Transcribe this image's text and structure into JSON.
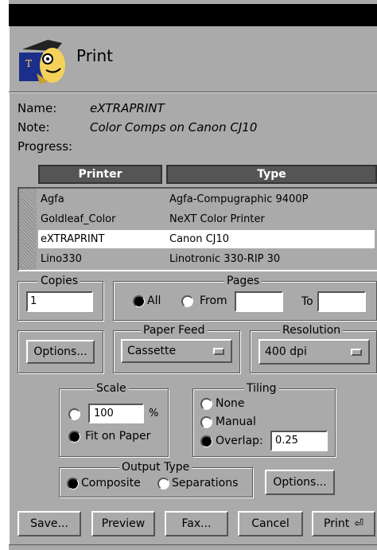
{
  "window": {
    "title": "Print"
  },
  "info": {
    "name_label": "Name:",
    "name_value": "eXTRAPRINT",
    "note_label": "Note:",
    "note_value": "Color Comps on Canon CJ10",
    "progress_label": "Progress:"
  },
  "printer_table": {
    "headers": [
      "Printer",
      "Type"
    ],
    "rows": [
      {
        "printer": "Agfa",
        "type": "Agfa-Compugraphic 9400P"
      },
      {
        "printer": "Goldleaf_Color",
        "type": "NeXT Color Printer"
      },
      {
        "printer": "eXTRAPRINT",
        "type": "Canon CJ10"
      },
      {
        "printer": "Lino330",
        "type": "Linotronic 330-RIP 30"
      }
    ],
    "selected_index": 2
  },
  "copies": {
    "label": "Copies",
    "value": "1"
  },
  "pages": {
    "label": "Pages",
    "all_label": "All",
    "from_label": "From",
    "to_label": "To",
    "from_value": "",
    "to_value": "",
    "selected": "All"
  },
  "options_button": "Options...",
  "paper_feed": {
    "label": "Paper Feed",
    "value": "Cassette"
  },
  "resolution": {
    "label": "Resolution",
    "value": "400 dpi"
  },
  "scale": {
    "label": "Scale",
    "percent_value": "100",
    "percent_sign": "%",
    "fit_label": "Fit on Paper",
    "selected": "Fit on Paper"
  },
  "tiling": {
    "label": "Tiling",
    "none_label": "None",
    "manual_label": "Manual",
    "overlap_label": "Overlap:",
    "overlap_value": "0.25",
    "selected": "Overlap"
  },
  "output_type": {
    "label": "Output Type",
    "composite_label": "Composite",
    "separations_label": "Separations",
    "selected": "Composite"
  },
  "output_options_button": "Options...",
  "buttons": {
    "save": "Save...",
    "preview": "Preview",
    "fax": "Fax...",
    "cancel": "Cancel",
    "print": "Print"
  },
  "colors": {
    "background": "#aaaaaa",
    "titlebar": "#000000",
    "selected_row": "#ffffff",
    "header_bar": "#555555"
  }
}
